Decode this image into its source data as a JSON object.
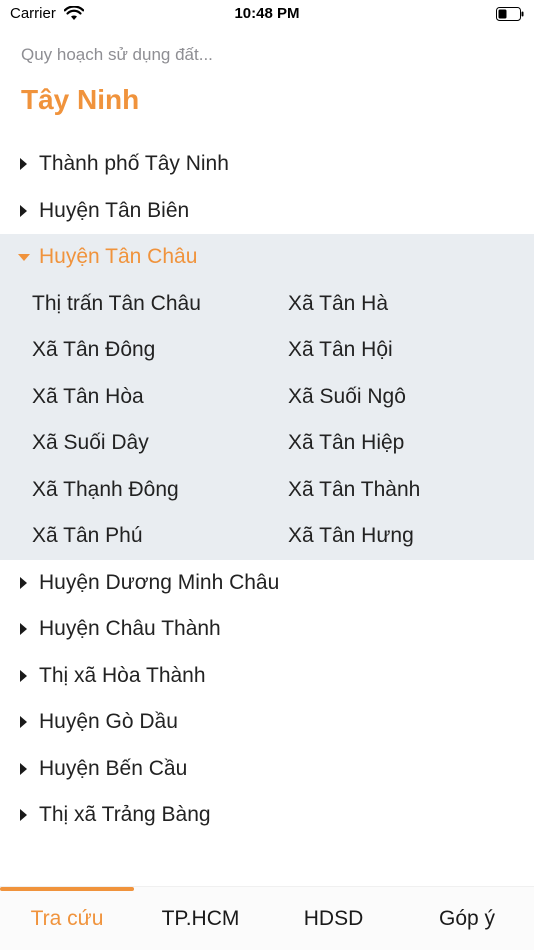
{
  "status_bar": {
    "carrier": "Carrier",
    "time": "10:48 PM"
  },
  "header": {
    "subtitle": "Quy hoạch sử dụng đất...",
    "title": "Tây Ninh"
  },
  "districts": [
    {
      "label": "Thành phố Tây Ninh",
      "expanded": false
    },
    {
      "label": "Huyện Tân Biên",
      "expanded": false
    },
    {
      "label": "Huyện Tân Châu",
      "expanded": true,
      "children": [
        "Thị trấn Tân Châu",
        "Xã Tân Hà",
        "Xã Tân Đông",
        "Xã Tân Hội",
        "Xã Tân Hòa",
        "Xã Suối Ngô",
        "Xã Suối Dây",
        "Xã Tân Hiệp",
        "Xã Thạnh Đông",
        "Xã Tân Thành",
        "Xã Tân Phú",
        "Xã Tân Hưng"
      ]
    },
    {
      "label": "Huyện Dương Minh Châu",
      "expanded": false
    },
    {
      "label": "Huyện Châu Thành",
      "expanded": false
    },
    {
      "label": "Thị xã Hòa Thành",
      "expanded": false
    },
    {
      "label": "Huyện Gò Dầu",
      "expanded": false
    },
    {
      "label": "Huyện Bến Cầu",
      "expanded": false
    },
    {
      "label": "Thị xã Trảng Bàng",
      "expanded": false
    }
  ],
  "tabs": [
    {
      "label": "Tra cứu",
      "active": true
    },
    {
      "label": "TP.HCM",
      "active": false
    },
    {
      "label": "HDSD",
      "active": false
    },
    {
      "label": "Góp ý",
      "active": false
    }
  ],
  "colors": {
    "accent": "#f0933c",
    "expanded_bg": "#e9edf1"
  },
  "icons": {
    "expand": "caret-right-icon",
    "collapse": "caret-down-icon",
    "wifi": "wifi-icon",
    "battery": "battery-icon"
  }
}
